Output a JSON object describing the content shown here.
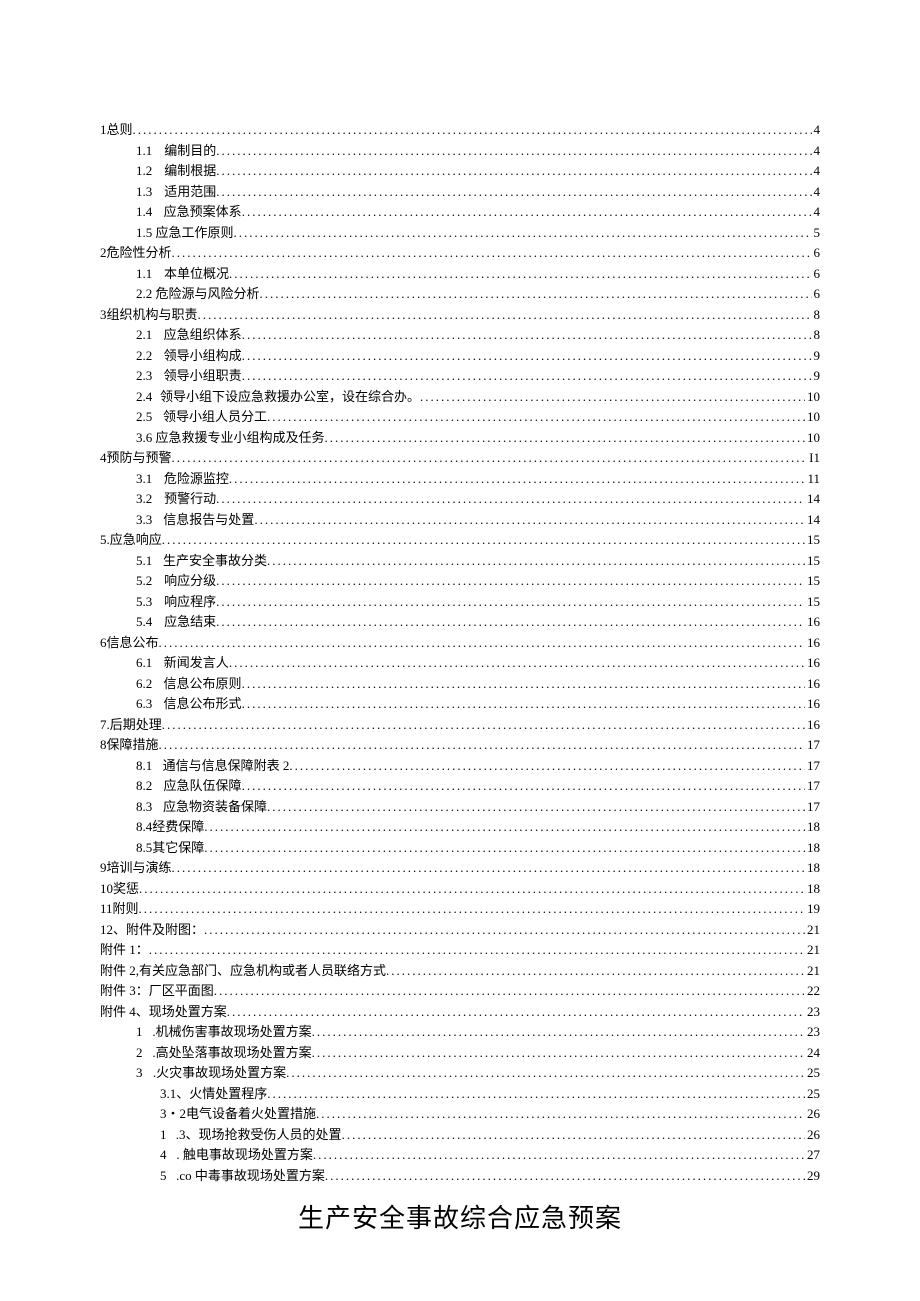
{
  "toc": [
    {
      "indent": 0,
      "num": "1",
      "label": "总则",
      "page": "4"
    },
    {
      "indent": 1,
      "num": "1.1",
      "gap": true,
      "label": "编制目的",
      "page": "4"
    },
    {
      "indent": 1,
      "num": "1.2",
      "gap": true,
      "label": "编制根据",
      "page": "4"
    },
    {
      "indent": 1,
      "num": "1.3",
      "gap": true,
      "label": "适用范围",
      "page": "4"
    },
    {
      "indent": 1,
      "num": "1.4",
      "gap": true,
      "label": "应急预案体系",
      "page": "4"
    },
    {
      "indent": 1,
      "num": "1.",
      "label": "  5 应急工作原则",
      "page": "5"
    },
    {
      "indent": 0,
      "num": "2",
      "label": "危险性分析",
      "page": "6"
    },
    {
      "indent": 1,
      "num": "1.1",
      "gap": true,
      "label": "本单位概况",
      "page": "6"
    },
    {
      "indent": 1,
      "num": "2.",
      "label": "  2 危险源与风险分析",
      "page": "6"
    },
    {
      "indent": 0,
      "num": "3",
      "label": "组织机构与职责",
      "page": "8"
    },
    {
      "indent": 1,
      "num": "2.1",
      "gap": true,
      "label": "应急组织体系",
      "page": "8"
    },
    {
      "indent": 1,
      "num": "2.2",
      "gap": true,
      "label": "领导小组构成",
      "page": "9"
    },
    {
      "indent": 1,
      "num": "2.3",
      "gap": true,
      "label": "领导小组职责",
      "page": "9"
    },
    {
      "indent": 1,
      "num": "2.4",
      "gap": true,
      "label": "领导小组下设应急救援办公室，设在综合办。",
      "page": "10"
    },
    {
      "indent": 1,
      "num": "2.5",
      "gap": true,
      "label": "领导小组人员分工",
      "page": "10"
    },
    {
      "indent": 1,
      "num": "3.",
      "label": "  6 应急救援专业小组构成及任务",
      "page": "10"
    },
    {
      "indent": 0,
      "num": "4",
      "label": "预防与预警",
      "page": "I1"
    },
    {
      "indent": 1,
      "num": "3.1",
      "gap": true,
      "label": "危险源监控",
      "page": "11"
    },
    {
      "indent": 1,
      "num": "3.2",
      "gap": true,
      "label": "预警行动",
      "page": "14"
    },
    {
      "indent": 1,
      "num": "3.3",
      "gap": true,
      "label": "信息报告与处置",
      "page": "14"
    },
    {
      "indent": 0,
      "num": "5.",
      "label": "应急响应",
      "page": "15"
    },
    {
      "indent": 1,
      "num": "5.1",
      "gap": true,
      "label": "生产安全事故分类",
      "page": "15"
    },
    {
      "indent": 1,
      "num": "5.2",
      "gap": true,
      "label": "响应分级",
      "page": "15"
    },
    {
      "indent": 1,
      "num": "5.3",
      "gap": true,
      "label": "响应程序",
      "page": "15"
    },
    {
      "indent": 1,
      "num": "5.4",
      "gap": true,
      "label": "应急结束",
      "page": "16"
    },
    {
      "indent": 0,
      "num": "6",
      "label": "信息公布",
      "page": "16"
    },
    {
      "indent": 1,
      "num": "6.1",
      "gap": true,
      "label": "新闻发言人",
      "page": "16"
    },
    {
      "indent": 1,
      "num": "6.2",
      "gap": true,
      "label": "信息公布原则",
      "page": "16"
    },
    {
      "indent": 1,
      "num": "6.3",
      "gap": true,
      "label": "信息公布形式",
      "page": "16"
    },
    {
      "indent": 0,
      "num": "7.",
      "label": "后期处理",
      "page": "16"
    },
    {
      "indent": 0,
      "num": "8",
      "label": "保障措施",
      "page": "17"
    },
    {
      "indent": 1,
      "num": "8.1",
      "gap": true,
      "label": "通信与信息保障附表 2",
      "page": "17"
    },
    {
      "indent": 1,
      "num": "8.2",
      "gap": true,
      "label": "应急队伍保障",
      "page": "17"
    },
    {
      "indent": 1,
      "num": "8.3",
      "gap": true,
      "label": "应急物资装备保障",
      "page": "17"
    },
    {
      "indent": 1,
      "num": "8.4",
      "label": "经费保障",
      "page": "18"
    },
    {
      "indent": 1,
      "num": "8.5",
      "label": "其它保障",
      "page": "18"
    },
    {
      "indent": 0,
      "num": "9",
      "label": "培训与演练",
      "page": "18"
    },
    {
      "indent": 0,
      "num": "10",
      "label": "奖惩",
      "page": "18"
    },
    {
      "indent": 0,
      "num": "11",
      "label": "附则",
      "page": "19"
    },
    {
      "indent": 0,
      "num": "12、",
      "label": "附件及附图：",
      "page": "21"
    },
    {
      "indent": 0,
      "num": "附件 1：",
      "label": "",
      "page": "21"
    },
    {
      "indent": 0,
      "num": "附件 2,",
      "label": "有关应急部门、应急机构或者人员联络方式",
      "page": "21"
    },
    {
      "indent": 0,
      "num": "附件 3：",
      "label": "厂区平面图",
      "page": "22"
    },
    {
      "indent": 0,
      "num": "附件 4、",
      "label": "现场处置方案",
      "page": "23"
    },
    {
      "indent": 1,
      "num": "1",
      "gap": true,
      "label": ".机械伤害事故现场处置方案",
      "page": "23"
    },
    {
      "indent": 1,
      "num": "2",
      "gap": true,
      "label": ".高处坠落事故现场处置方案",
      "page": "24"
    },
    {
      "indent": 1,
      "num": "3",
      "gap": true,
      "label": ".火灾事故现场处置方案",
      "page": "25"
    },
    {
      "indent": 2,
      "num": "3.1、",
      "label": "  火情处置程序",
      "page": "25"
    },
    {
      "indent": 2,
      "num": "3・2",
      "label": "电气设备着火处置措施",
      "page": "26"
    },
    {
      "indent": 2,
      "num": "1",
      "gap": true,
      "label": ".3、现场抢救受伤人员的处置",
      "page": "26"
    },
    {
      "indent": 2,
      "num": "4",
      "gap": true,
      "label": ".  触电事故现场处置方案",
      "page": "27"
    },
    {
      "indent": 2,
      "num": "5",
      "gap": true,
      "label": ".co 中毒事故现场处置方案",
      "page": "29"
    }
  ],
  "title": "生产安全事故综合应急预案"
}
